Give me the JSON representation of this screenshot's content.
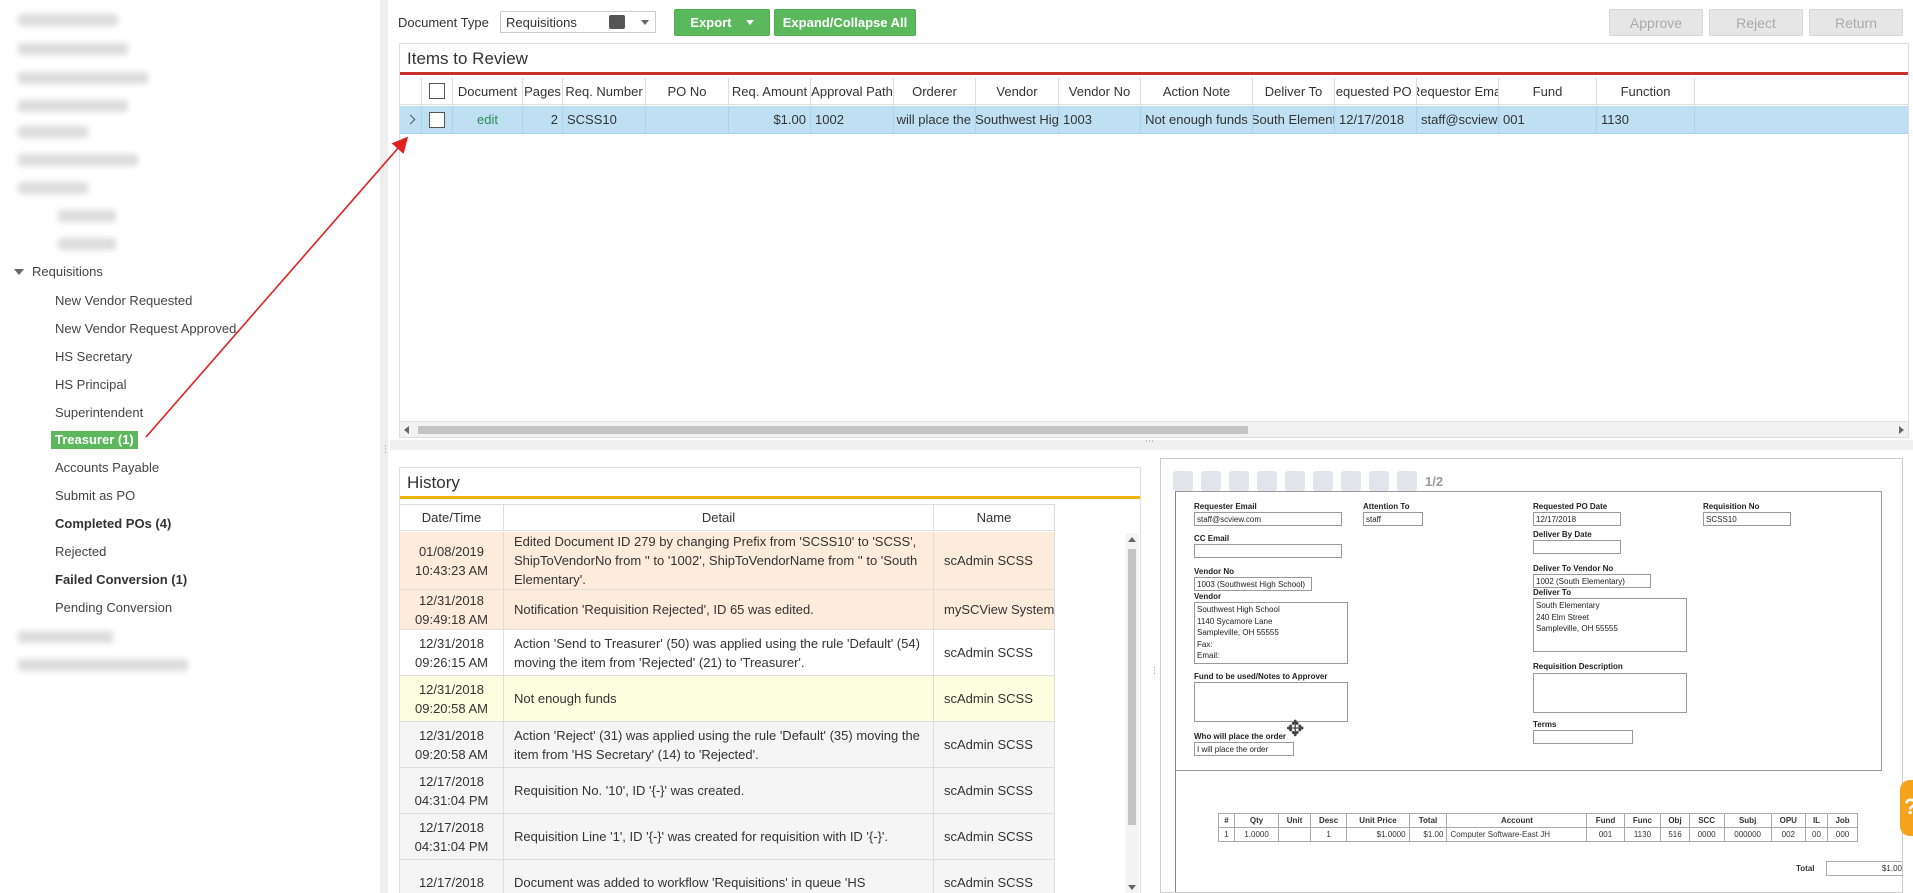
{
  "sidebar": {
    "section_label": "Requisitions",
    "items": [
      {
        "label": "New Vendor Requested",
        "style": "normal"
      },
      {
        "label": "New Vendor Request Approved",
        "style": "normal"
      },
      {
        "label": "HS Secretary",
        "style": "normal"
      },
      {
        "label": "HS Principal",
        "style": "normal"
      },
      {
        "label": "Superintendent",
        "style": "normal"
      },
      {
        "label": "Treasurer (1)",
        "style": "active"
      },
      {
        "label": "Accounts Payable",
        "style": "normal"
      },
      {
        "label": "Submit as PO",
        "style": "normal"
      },
      {
        "label": "Completed POs (4)",
        "style": "bold"
      },
      {
        "label": "Rejected",
        "style": "normal"
      },
      {
        "label": "Failed Conversion (1)",
        "style": "bold"
      },
      {
        "label": "Pending Conversion",
        "style": "normal"
      }
    ]
  },
  "toolbar": {
    "doc_type_label": "Document Type",
    "doc_type_value": "Requisitions",
    "export_label": "Export",
    "expand_collapse_label": "Expand/Collapse All",
    "approve_label": "Approve",
    "reject_label": "Reject",
    "return_label": "Return"
  },
  "items_panel": {
    "title": "Items to Review",
    "columns": [
      "Document",
      "Pages",
      "Req. Number",
      "PO No",
      "Req. Amount",
      "Approval Path",
      "Orderer",
      "Vendor",
      "Vendor No",
      "Action Note",
      "Deliver To",
      "Requested PO D",
      "Requestor Emai",
      "Fund",
      "Function"
    ],
    "row": {
      "document": "edit",
      "pages": "2",
      "req_number": "SCSS10",
      "po_no": "",
      "req_amount": "$1.00",
      "approval_path": "1002",
      "orderer": "I will place the",
      "vendor": "Southwest Hig",
      "vendor_no": "1003",
      "action_note": "Not enough funds",
      "deliver_to": "South Element",
      "requested_po_date": "12/17/2018",
      "requestor_email": "staff@scview.c",
      "fund": "001",
      "function": "1130"
    }
  },
  "history": {
    "title": "History",
    "columns": [
      "Date/Time",
      "Detail",
      "Name"
    ],
    "rows": [
      {
        "date": "01/08/2019",
        "time": "10:43:23 AM",
        "detail": "Edited Document ID 279 by changing Prefix from 'SCSS10' to 'SCSS', ShipToVendorNo from '' to '1002', ShipToVendorName from '' to 'South Elementary'.",
        "name": "scAdmin SCSS",
        "bg": "#fdebdc"
      },
      {
        "date": "12/31/2018",
        "time": "09:49:18 AM",
        "detail": "Notification 'Requisition Rejected', ID 65 was edited.",
        "name": "mySCView System",
        "bg": "#fdebdc"
      },
      {
        "date": "12/31/2018",
        "time": "09:26:15 AM",
        "detail": "Action 'Send to Treasurer' (50) was applied using the rule 'Default' (54) moving the item from 'Rejected' (21) to 'Treasurer'.",
        "name": "scAdmin SCSS",
        "bg": "#ffffff"
      },
      {
        "date": "12/31/2018",
        "time": "09:20:58 AM",
        "detail": "Not enough funds",
        "name": "scAdmin SCSS",
        "bg": "#fdfde0"
      },
      {
        "date": "12/31/2018",
        "time": "09:20:58 AM",
        "detail": "Action 'Reject' (31) was applied using the rule 'Default' (35) moving the item from 'HS Secretary' (14) to 'Rejected'.",
        "name": "scAdmin SCSS",
        "bg": "#f5f5f5"
      },
      {
        "date": "12/17/2018",
        "time": "04:31:04 PM",
        "detail": "Requisition No. '10', ID '{-}' was created.",
        "name": "scAdmin SCSS",
        "bg": "#f5f5f5"
      },
      {
        "date": "12/17/2018",
        "time": "04:31:04 PM",
        "detail": "Requisition Line '1', ID '{-}' was created for requisition with ID '{-}'.",
        "name": "scAdmin SCSS",
        "bg": "#f5f5f5"
      },
      {
        "date": "12/17/2018",
        "time": "",
        "detail": "Document was added to workflow 'Requisitions' in queue 'HS",
        "name": "scAdmin SCSS",
        "bg": "#f5f5f5"
      }
    ]
  },
  "viewer": {
    "page_indicator": "1/2",
    "fields": {
      "requester_email_label": "Requester Email",
      "requester_email": "staff@scview.com",
      "attention_to_label": "Attention To",
      "attention_to": "staff",
      "requested_po_date_label": "Requested PO Date",
      "requested_po_date": "12/17/2018",
      "requisition_no_label": "Requisition No",
      "requisition_no": "SCSS10",
      "cc_email_label": "CC Email",
      "deliver_by_label": "Deliver By Date",
      "vendor_no_label": "Vendor No",
      "vendor_no": "1003 (Southwest High School)",
      "deliver_to_vendor_no_label": "Deliver To Vendor No",
      "deliver_to_vendor_no": "1002 (South Elementary)",
      "vendor_label": "Vendor",
      "vendor_lines": [
        "Southwest High School",
        "1140 Sycamore Lane",
        "Sampleville, OH 55555",
        "Fax:",
        "Email:"
      ],
      "deliver_to_label": "Deliver To",
      "deliver_to_lines": [
        "South Elementary",
        "240 Elm Street",
        "Sampleville, OH 55555"
      ],
      "requisition_description_label": "Requisition Description",
      "fund_notes_label": "Fund to be used/Notes to Approver",
      "terms_label": "Terms",
      "who_orders_label": "Who will place the order",
      "who_orders": "I will place the order"
    },
    "table_headers": [
      "#",
      "Qty",
      "Unit",
      "Desc",
      "Unit Price",
      "Total",
      "Account",
      "Fund",
      "Func",
      "Obj",
      "SCC",
      "Subj",
      "OPU",
      "IL",
      "Job"
    ],
    "table_row": [
      "1",
      "1.0000",
      "",
      "1",
      "$1.0000",
      "$1.00",
      "Computer Software-East JH",
      "001",
      "1130",
      "516",
      "0000",
      "000000",
      "002",
      "00",
      "000"
    ],
    "total_label": "Total",
    "total_value": "$1.00"
  },
  "help_label": "?",
  "colors": {
    "accent_green": "#5cb85c",
    "selected_row": "#bfe0f2",
    "items_rule": "#c9302c",
    "history_rule": "#f0b400",
    "annotation_arrow": "#e02020"
  }
}
